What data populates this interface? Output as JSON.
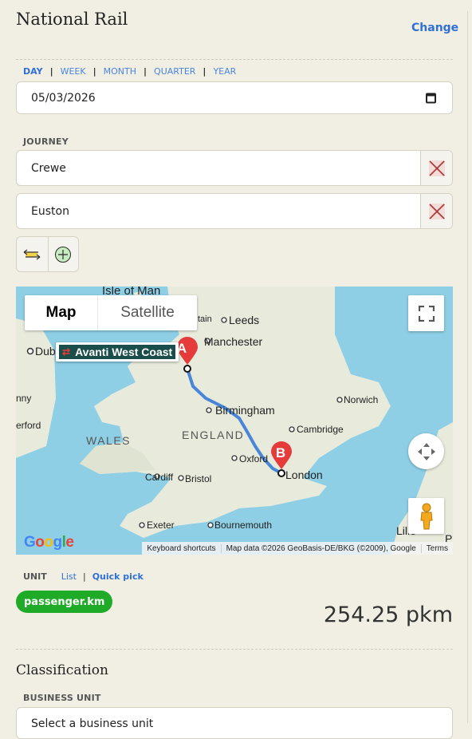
{
  "header": {
    "title": "National Rail",
    "change_label": "Change"
  },
  "periods": {
    "items": [
      "DAY",
      "WEEK",
      "MONTH",
      "QUARTER",
      "YEAR"
    ],
    "separator": "|",
    "active": "DAY"
  },
  "date_field": {
    "value": "05/03/2026",
    "icon": "calendar-icon"
  },
  "journey": {
    "label": "JOURNEY",
    "from": "Crewe",
    "to": "Euston",
    "remove_icon": "remove-x-icon",
    "swap_icon": "swap-arrows-icon",
    "add_icon": "add-circle-icon"
  },
  "map": {
    "type_map": "Map",
    "type_satellite": "Satellite",
    "operator": "Avanti West Coast",
    "marker_a": "A",
    "marker_b": "B",
    "places": {
      "isle_of_man": "Isle of Man",
      "tain": "tain",
      "leeds": "Leeds",
      "manchester": "Manchester",
      "dub": "Dub",
      "norwich": "Norwich",
      "birmingham": "Birmingham",
      "cambridge": "Cambridge",
      "nny": "nny",
      "erford": "erford",
      "wales": "WALES",
      "england": "ENGLAND",
      "oxford": "Oxford",
      "london": "London",
      "cardiff": "Cardiff",
      "bristol": "Bristol",
      "exeter": "Exeter",
      "bournemouth": "Bournemouth",
      "lille": "Lille",
      "p": "P"
    },
    "google": "Google",
    "keyboard_shortcuts": "Keyboard shortcuts",
    "map_data": "Map data ©2026 GeoBasis-DE/BKG (©2009), Google",
    "terms": "Terms",
    "colors": {
      "water": "#8ecfe6",
      "land": "#e8ebdc",
      "route": "#4a86d8",
      "marker": "#e53b3b"
    }
  },
  "unit": {
    "label": "UNIT",
    "list_label": "List",
    "separator": "|",
    "quick_pick_label": "Quick pick",
    "selected": "passenger.km",
    "total": "254.25 pkm"
  },
  "classification": {
    "title": "Classification",
    "business_unit_label": "BUSINESS UNIT",
    "business_unit_placeholder": "Select a business unit"
  }
}
